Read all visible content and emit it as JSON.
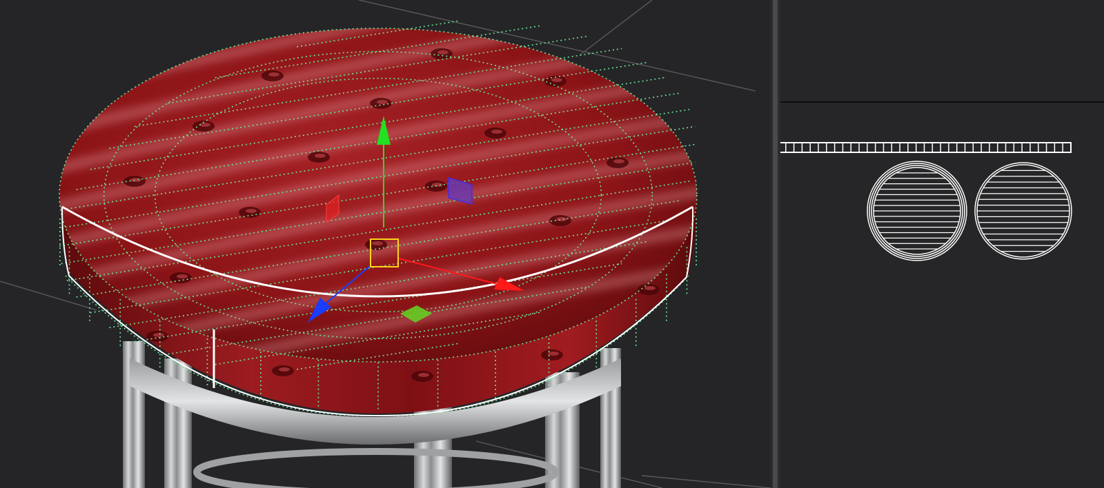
{
  "app": {
    "panels": {
      "viewport": "3d-viewport",
      "inspector": "top-panel",
      "uv_editor": "uv-editor"
    }
  },
  "colors": {
    "background": "#252527",
    "grid_line": "#5a5a5e",
    "wireframe": "#6ee89a",
    "seam": "#ffffff",
    "leather_base": "#8d1518",
    "chrome": "#b9bbbc",
    "gizmo_x": "#ff1a1a",
    "gizmo_y": "#22e022",
    "gizmo_z": "#1a3cff",
    "gizmo_center": "#ffd41a",
    "plane_xz": "#66cc22",
    "plane_xy": "#6a3ab0",
    "plane_yz": "#dd2222"
  },
  "gizmo": {
    "mode": "move",
    "axes": [
      "x",
      "y",
      "z"
    ],
    "planes": [
      "xy",
      "yz",
      "xz"
    ]
  },
  "uv": {
    "islands": [
      "side-strip",
      "top-disc",
      "bottom-disc"
    ],
    "strip_segments": 36
  },
  "icons": {
    "x_arrow": "x-axis-arrow-icon",
    "y_arrow": "y-axis-arrow-icon",
    "z_arrow": "z-axis-arrow-icon",
    "center": "gizmo-center-handle-icon"
  }
}
